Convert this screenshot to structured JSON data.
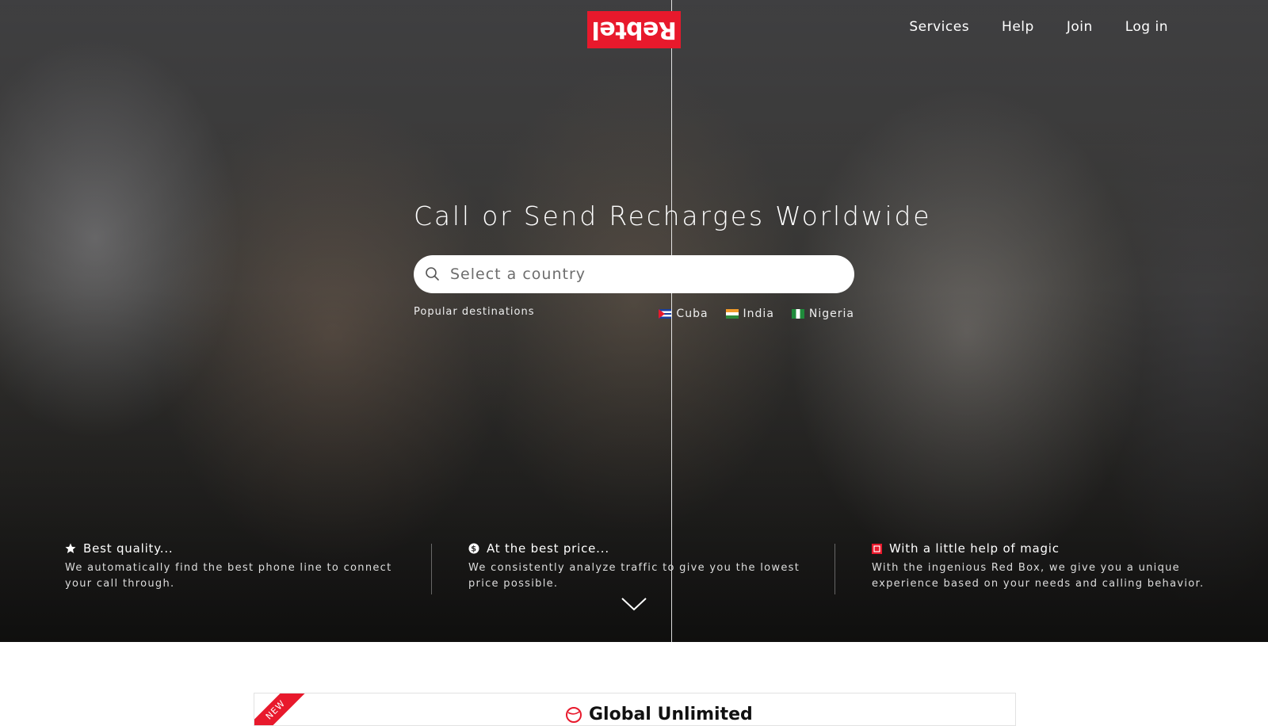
{
  "brand": {
    "logo_text": "Rebtel",
    "accent_color": "#e8192c"
  },
  "nav": {
    "items": [
      "Services",
      "Help",
      "Join",
      "Log in"
    ]
  },
  "hero": {
    "headline": "Call or Send Recharges Worldwide",
    "search_placeholder": "Select a country",
    "popular_label": "Popular destinations",
    "destinations": [
      {
        "name": "Cuba",
        "flag": "cuba-flag-icon"
      },
      {
        "name": "India",
        "flag": "india-flag-icon"
      },
      {
        "name": "Nigeria",
        "flag": "nigeria-flag-icon"
      }
    ]
  },
  "features": [
    {
      "icon": "star-icon",
      "title": "Best quality...",
      "desc": "We automatically find the best phone line to connect your call through."
    },
    {
      "icon": "dollar-icon",
      "title": "At the best price...",
      "desc": "We consistently analyze traffic to give you the lowest price possible."
    },
    {
      "icon": "red-box-icon",
      "title": "With a little help of magic",
      "desc": "With the ingenious Red Box, we give you a unique experience based on your needs and calling behavior."
    }
  ],
  "promo": {
    "ribbon": "NEW",
    "title": "Global Unlimited"
  }
}
